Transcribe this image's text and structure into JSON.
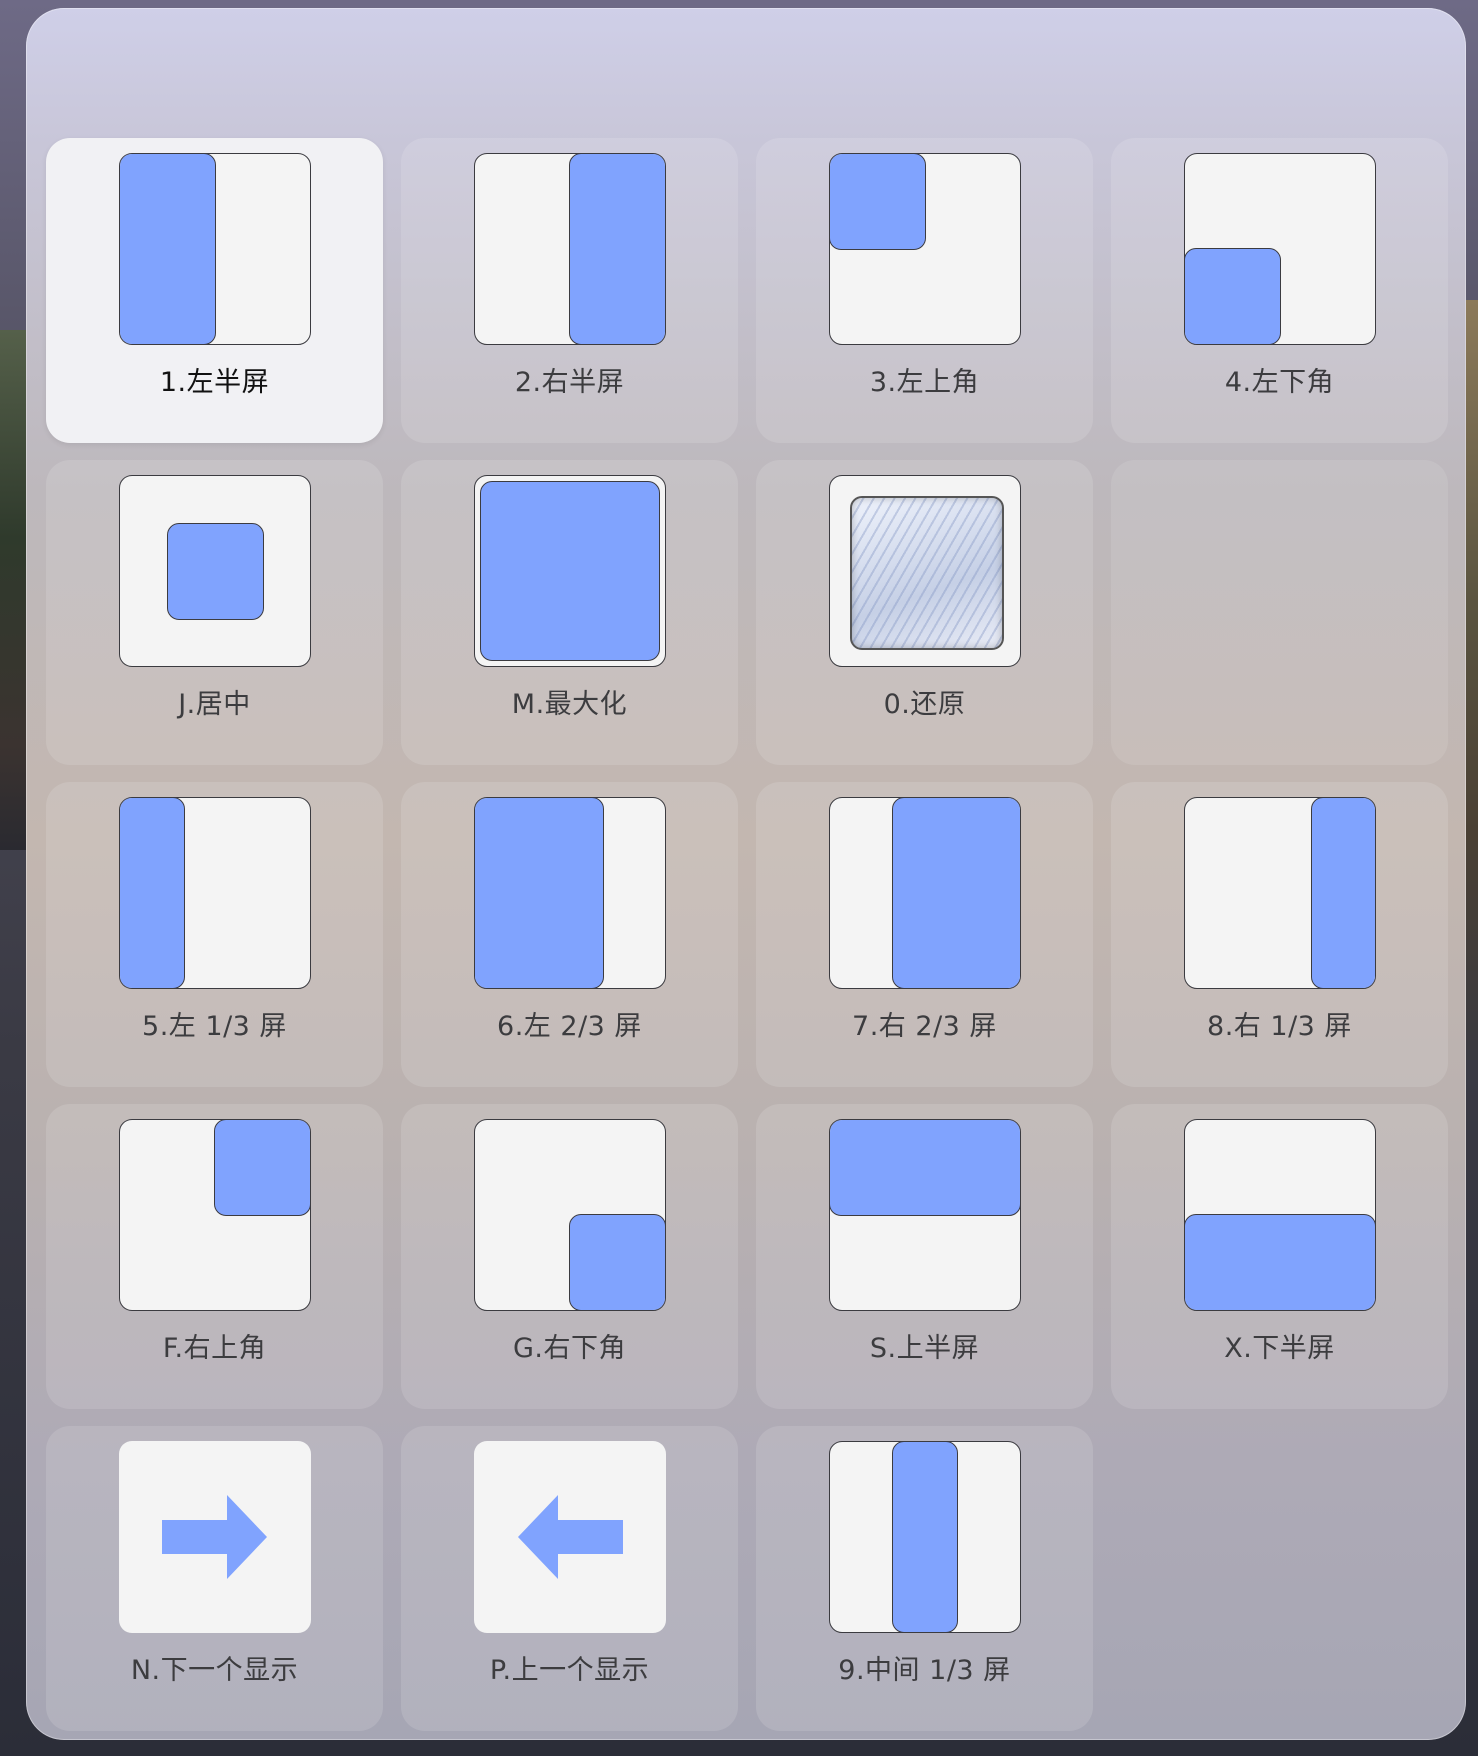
{
  "colors": {
    "accent_fill": "#80a3fe",
    "thumb_bg": "#f4f4f4",
    "tile_active": "#f1f1f4"
  },
  "tiles": [
    {
      "label": "1.左半屏",
      "icon": "left-half-icon"
    },
    {
      "label": "2.右半屏",
      "icon": "right-half-icon"
    },
    {
      "label": "3.左上角",
      "icon": "top-left-corner-icon"
    },
    {
      "label": "4.左下角",
      "icon": "bottom-left-corner-icon"
    },
    {
      "label": "J.居中",
      "icon": "center-icon"
    },
    {
      "label": "M.最大化",
      "icon": "maximize-icon"
    },
    {
      "label": "0.还原",
      "icon": "restore-icon"
    },
    {
      "label": "5.左 1/3 屏",
      "icon": "left-third-icon"
    },
    {
      "label": "6.左 2/3 屏",
      "icon": "left-two-thirds-icon"
    },
    {
      "label": "7.右 2/3 屏",
      "icon": "right-two-thirds-icon"
    },
    {
      "label": "8.右 1/3 屏",
      "icon": "right-third-icon"
    },
    {
      "label": "F.右上角",
      "icon": "top-right-corner-icon"
    },
    {
      "label": "G.右下角",
      "icon": "bottom-right-corner-icon"
    },
    {
      "label": "S.上半屏",
      "icon": "top-half-icon"
    },
    {
      "label": "X.下半屏",
      "icon": "bottom-half-icon"
    },
    {
      "label": "N.下一个显示",
      "icon": "arrow-right-icon"
    },
    {
      "label": "P.上一个显示",
      "icon": "arrow-left-icon"
    },
    {
      "label": "9.中间 1/3 屏",
      "icon": "center-third-icon"
    }
  ]
}
